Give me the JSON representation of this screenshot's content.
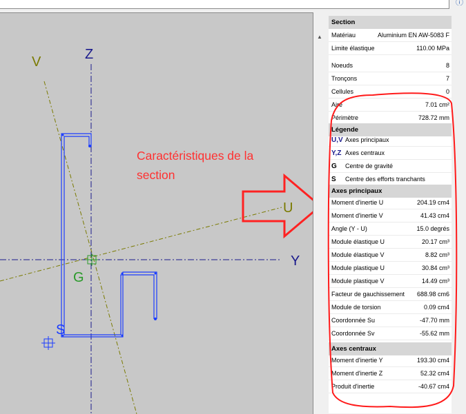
{
  "help_icon": "help-circle-icon",
  "drawing": {
    "axis_labels": {
      "v": "V",
      "z": "Z",
      "u": "U",
      "y": "Y",
      "g": "G",
      "s": "S"
    },
    "colors": {
      "background": "#c8c8c8",
      "section_outline": "#1a3cff",
      "central_axes": "#1a1a8c",
      "principal_axes": "#7a7a00",
      "gravity_center": "#2a9a2a"
    }
  },
  "annotation": {
    "line1": "Caractéristiques de la",
    "line2": "section",
    "color": "#ff3131"
  },
  "panel": {
    "section": {
      "header": "Section",
      "material_label": "Matériau",
      "material_value": "Aluminium EN AW-5083 F",
      "yield_label": "Limite élastique",
      "yield_value": "110.00 MPa",
      "nodes_label": "Noeuds",
      "nodes_value": "8",
      "segments_label": "Tronçons",
      "segments_value": "7",
      "cells_label": "Cellules",
      "cells_value": "0",
      "area_label": "Aire",
      "area_value": "7.01 cm²",
      "perimeter_label": "Périmètre",
      "perimeter_value": "728.72 mm"
    },
    "legend": {
      "header": "Légende",
      "items": [
        {
          "symbol": "U,V",
          "text": "Axes principaux"
        },
        {
          "symbol": "Y,Z",
          "text": "Axes centraux"
        },
        {
          "symbol": "G",
          "text": "Centre de gravité"
        },
        {
          "symbol": "S",
          "text": "Centre des efforts tranchants"
        }
      ]
    },
    "principal": {
      "header": "Axes principaux",
      "rows": [
        {
          "label": "Moment d'inertie U",
          "value": "204.19 cm4"
        },
        {
          "label": "Moment d'inertie V",
          "value": "41.43 cm4"
        },
        {
          "label": "Angle (Y - U)",
          "value": "15.0 degrés"
        },
        {
          "label": "Module élastique U",
          "value": "20.17 cm³"
        },
        {
          "label": "Module élastique V",
          "value": "8.82 cm³"
        },
        {
          "label": "Module plastique U",
          "value": "30.84 cm³"
        },
        {
          "label": "Module plastique V",
          "value": "14.49 cm³"
        },
        {
          "label": "Facteur de gauchissement",
          "value": "688.98 cm6"
        },
        {
          "label": "Module de torsion",
          "value": "0.09 cm4"
        },
        {
          "label": "Coordonnée Su",
          "value": "-47.70 mm"
        },
        {
          "label": "Coordonnée Sv",
          "value": "-55.62 mm"
        }
      ]
    },
    "central": {
      "header": "Axes centraux",
      "rows": [
        {
          "label": "Moment d'inertie Y",
          "value": "193.30 cm4"
        },
        {
          "label": "Moment d'inertie Z",
          "value": "52.32 cm4"
        },
        {
          "label": "Produit d'inertie",
          "value": "-40.67 cm4"
        }
      ]
    }
  }
}
